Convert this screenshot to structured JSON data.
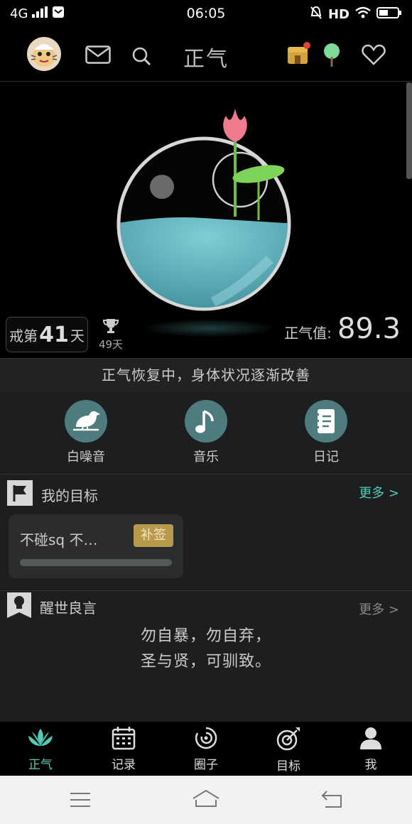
{
  "status_bar": {
    "network": "4G",
    "time": "06:05",
    "hd": "HD"
  },
  "header": {
    "title": "正气"
  },
  "hero": {
    "streak_prefix": "戒第",
    "streak_days": "41",
    "streak_suffix": "天",
    "best_days": "49天",
    "score_label": "正气值:",
    "score_value": "89.3"
  },
  "status_message": "正气恢复中，身体状况逐渐改善",
  "shortcuts": [
    {
      "label": "白噪音",
      "icon": "bird-icon"
    },
    {
      "label": "音乐",
      "icon": "music-note-icon"
    },
    {
      "label": "日记",
      "icon": "notebook-icon"
    }
  ],
  "goals": {
    "title": "我的目标",
    "more": "更多 >",
    "card": {
      "text": "不碰sq 不…",
      "badge": "补签",
      "progress": 0.0
    }
  },
  "quotes": {
    "title": "醒世良言",
    "more": "更多 >",
    "line1": "勿自暴，勿自弃，",
    "line2": "圣与贤，可驯致。"
  },
  "bottom_nav": [
    {
      "label": "正气",
      "active": true
    },
    {
      "label": "记录",
      "active": false
    },
    {
      "label": "圈子",
      "active": false
    },
    {
      "label": "目标",
      "active": false
    },
    {
      "label": "我",
      "active": false
    }
  ],
  "colors": {
    "accent": "#56c9b5",
    "water": "#5fb4bf",
    "lotus": "#f07a8e",
    "badge": "#b89a4d"
  }
}
